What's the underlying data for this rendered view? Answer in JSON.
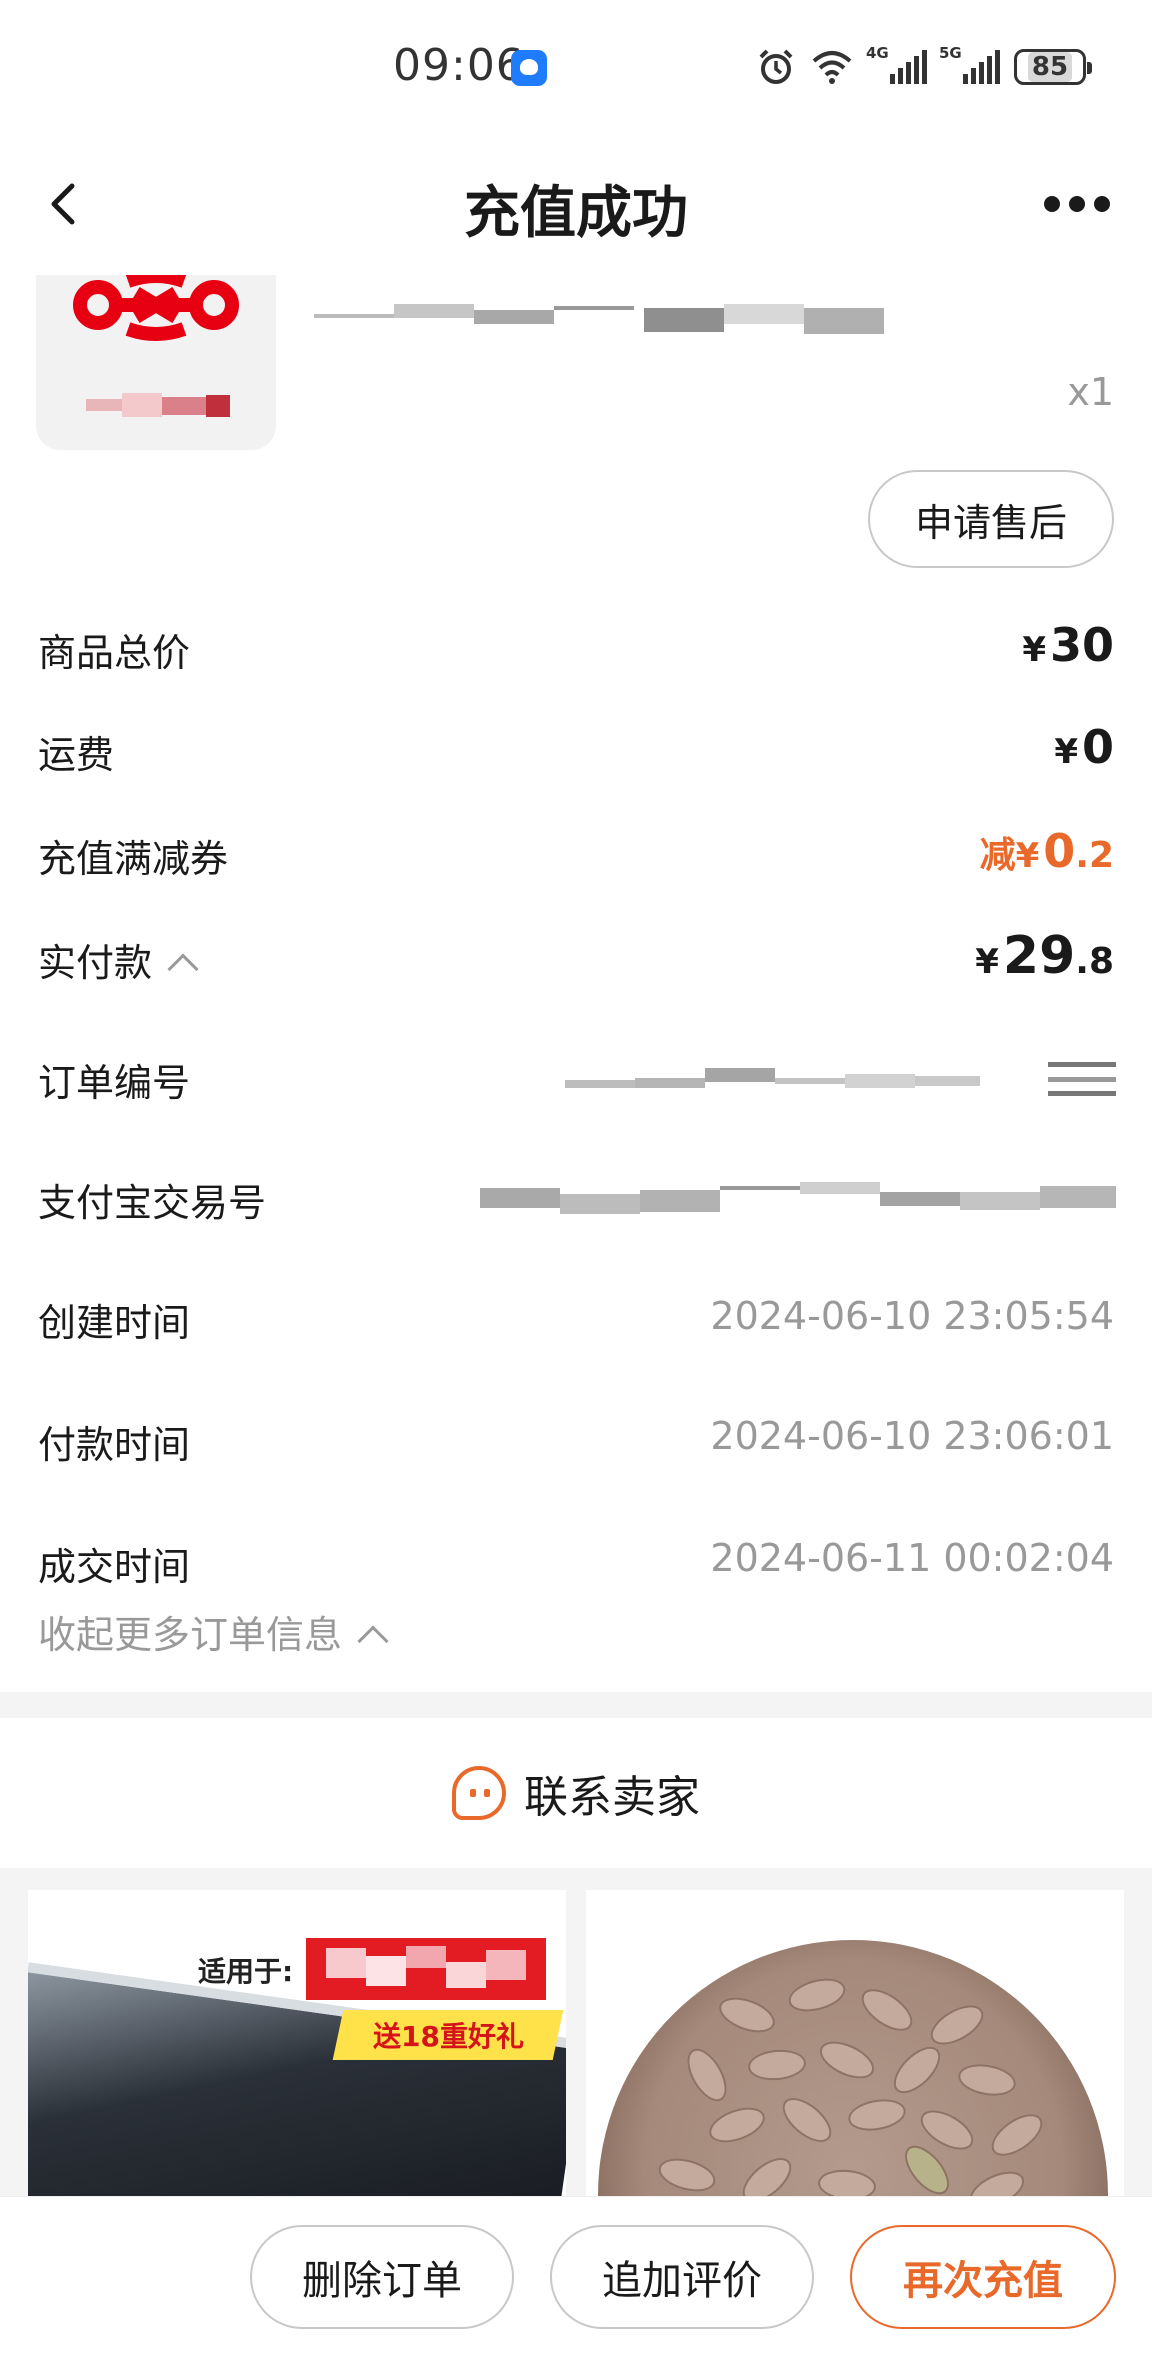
{
  "status_bar": {
    "time": "09:06",
    "battery": "85",
    "net_a": "4G",
    "net_b": "5G"
  },
  "header": {
    "title": "充值成功"
  },
  "product": {
    "quantity": "x1",
    "aftersale_label": "申请售后"
  },
  "price": {
    "goods_total": {
      "label": "商品总价",
      "currency": "¥",
      "amount": "30"
    },
    "shipping": {
      "label": "运费",
      "currency": "¥",
      "amount": "0"
    },
    "coupon": {
      "label": "充值满减券",
      "prefix": "减",
      "currency": "¥",
      "amount_int": "0",
      "amount_dec": ".2"
    },
    "paid": {
      "label": "实付款",
      "currency": "¥",
      "amount_int": "29",
      "amount_dec": ".8"
    }
  },
  "order_info": {
    "order_no_label": "订单编号",
    "alipay_no_label": "支付宝交易号",
    "created": {
      "label": "创建时间",
      "value": "2024-06-10 23:05:54"
    },
    "paid": {
      "label": "付款时间",
      "value": "2024-06-10 23:06:01"
    },
    "completed": {
      "label": "成交时间",
      "value": "2024-06-11 00:02:04"
    },
    "collapse_label": "收起更多订单信息"
  },
  "contact": {
    "label": "联系卖家"
  },
  "recommend": {
    "left": {
      "fit_text": "适用于:",
      "promo_text": "送18重好礼"
    }
  },
  "actions": {
    "delete_label": "删除订单",
    "review_label": "追加评价",
    "recharge_label": "再次充值"
  },
  "colors": {
    "accent": "#e8692a",
    "muted": "#999999",
    "text": "#1a1a1a",
    "brand_red": "#e31b23"
  },
  "icons": [
    "back-icon",
    "more-icon",
    "alarm-icon",
    "wifi-icon",
    "signal-icon",
    "battery-icon",
    "chevron-up-icon",
    "copy-icon",
    "contact-seller-icon"
  ]
}
